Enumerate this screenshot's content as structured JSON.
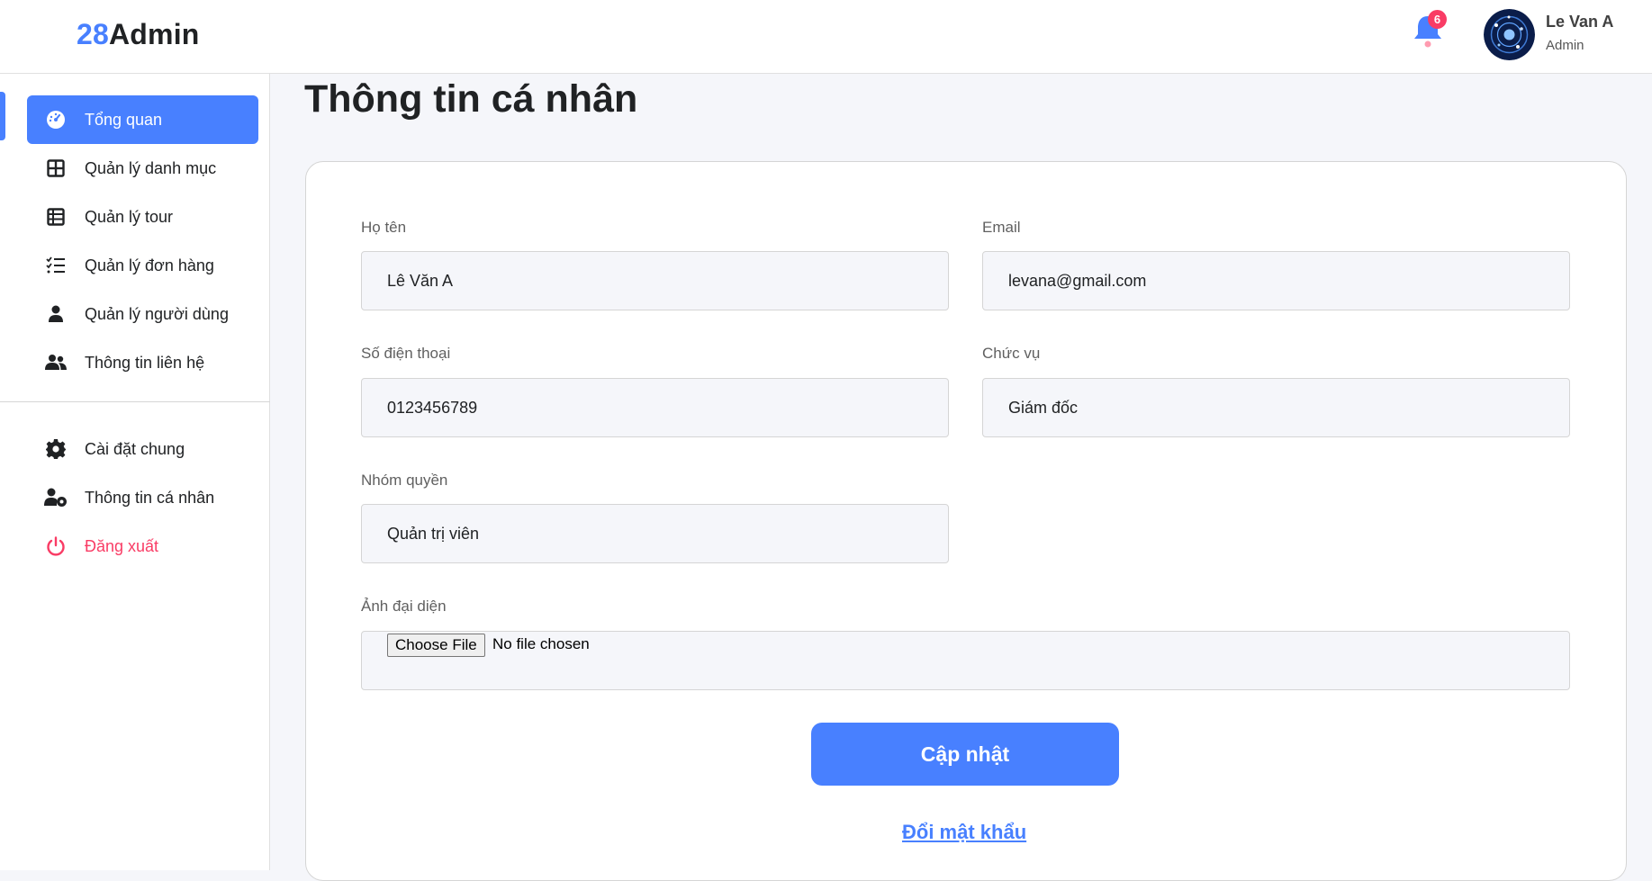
{
  "header": {
    "logo_prefix": "28",
    "logo_suffix": "Admin",
    "notification_count": "6",
    "user_name": "Le Van A",
    "user_role": "Admin"
  },
  "sidebar": {
    "items": [
      {
        "label": "Tổng quan",
        "icon": "dashboard-gauge-icon"
      },
      {
        "label": "Quản lý danh mục",
        "icon": "grid-icon"
      },
      {
        "label": "Quản lý tour",
        "icon": "table-icon"
      },
      {
        "label": "Quản lý đơn hàng",
        "icon": "checklist-icon"
      },
      {
        "label": "Quản lý người dùng",
        "icon": "user-icon"
      },
      {
        "label": "Thông tin liên hệ",
        "icon": "users-icon"
      }
    ],
    "bottom_items": [
      {
        "label": "Cài đặt chung",
        "icon": "gear-icon"
      },
      {
        "label": "Thông tin cá nhân",
        "icon": "user-gear-icon"
      },
      {
        "label": "Đăng xuất",
        "icon": "power-icon"
      }
    ]
  },
  "main": {
    "title": "Thông tin cá nhân",
    "form": {
      "fullname_label": "Họ tên",
      "fullname_value": "Lê Văn A",
      "email_label": "Email",
      "email_value": "levana@gmail.com",
      "phone_label": "Số điện thoại",
      "phone_value": "0123456789",
      "position_label": "Chức vụ",
      "position_value": "Giám đốc",
      "role_label": "Nhóm quyền",
      "role_value": "Quản trị viên",
      "avatar_label": "Ảnh đại diện",
      "choose_file_label": "Choose File",
      "no_file_text": "No file chosen",
      "submit_label": "Cập nhật",
      "change_password_label": "Đổi mật khẩu"
    }
  },
  "colors": {
    "accent": "#4880ff",
    "danger": "#f93c65",
    "background": "#f5f6fa"
  }
}
